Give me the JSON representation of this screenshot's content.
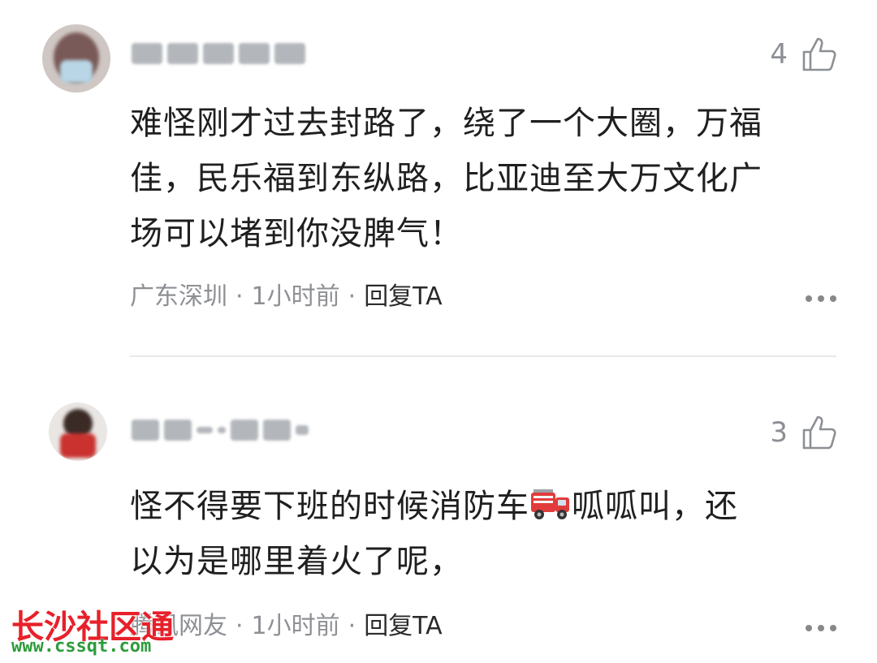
{
  "comments": [
    {
      "likes": "4",
      "text_lines": [
        "难怪刚才过去封路了，绕了一个大圈，万福",
        "佳，民乐福到东纵路，比亚迪至大万文化广",
        "场可以堵到你没脾气！"
      ],
      "location": "广东深圳",
      "time": "1小时前",
      "reply": "回复TA"
    },
    {
      "likes": "3",
      "text_line1_a": "怪不得要下班的时候消防车",
      "text_line1_b": "呱呱叫，还",
      "text_line2": "以为是哪里着火了呢，",
      "location": "腾讯网友",
      "time": "1小时前",
      "reply": "回复TA"
    }
  ],
  "separator": "·",
  "icons": {
    "like": "thumbs-up-icon",
    "more": "more-dots-icon",
    "emoji": "fire-truck-emoji"
  },
  "watermark": {
    "title": "长沙社区通",
    "url": "www.cssqt.com"
  },
  "colors": {
    "text": "#1f1f1f",
    "meta": "#8e9095",
    "watermark": "#e8202a",
    "watermark_url": "#2d9c3b"
  }
}
